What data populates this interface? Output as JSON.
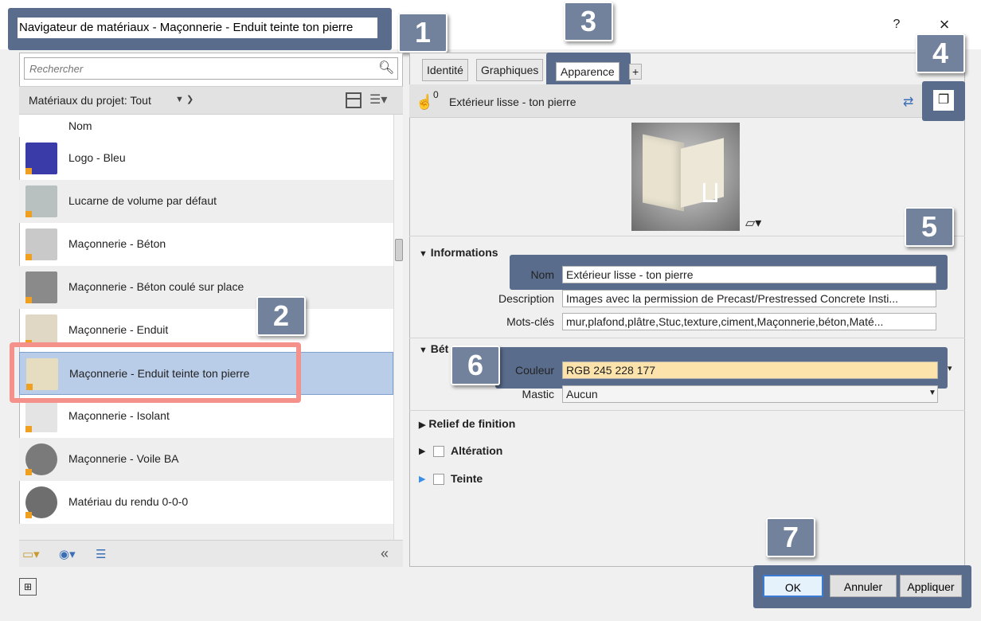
{
  "window": {
    "title": "Navigateur de matériaux - Maçonnerie - Enduit teinte ton pierre",
    "help": "?",
    "close": "×"
  },
  "badges": [
    "1",
    "2",
    "3",
    "4",
    "5",
    "6",
    "7"
  ],
  "browser": {
    "search_placeholder": "Rechercher",
    "filter_label": "Matériaux du projet: Tout",
    "column_header": "Nom",
    "materials": [
      {
        "name": "Logo - Bleu",
        "swatch": "#3a3aa8"
      },
      {
        "name": "Lucarne de volume par défaut",
        "swatch": "#b8c0c0"
      },
      {
        "name": "Maçonnerie - Béton",
        "swatch": "#c9c9c9"
      },
      {
        "name": "Maçonnerie - Béton coulé sur place",
        "swatch": "#8a8a8a"
      },
      {
        "name": "Maçonnerie - Enduit",
        "swatch": "#e0d8c4"
      },
      {
        "name": "Maçonnerie - Enduit teinte ton pierre",
        "swatch": "#e6dcc0",
        "selected": true
      },
      {
        "name": "Maçonnerie - Isolant",
        "swatch": "#e4e4e4"
      },
      {
        "name": "Maçonnerie - Voile BA",
        "swatch": "#7a7a7a"
      },
      {
        "name": "Matériau du rendu 0-0-0",
        "swatch": "#6e6e6e"
      }
    ],
    "collapse": "«"
  },
  "editor": {
    "tabs": [
      "Identité",
      "Graphiques",
      "Apparence",
      "+"
    ],
    "asset_count": "0",
    "asset_name": "Extérieur lisse - ton pierre",
    "sections": {
      "informations": "Informations",
      "beton": "Bét",
      "relief": "Relief de finition",
      "alteration": "Altération",
      "teinte": "Teinte"
    },
    "info": {
      "nom_label": "Nom",
      "nom_value": "Extérieur lisse - ton pierre",
      "description_label": "Description",
      "description_value": "Images avec la permission de Precast/Prestressed Concrete Insti...",
      "motscles_label": "Mots-clés",
      "motscles_value": "mur,plafond,plâtre,Stuc,texture,ciment,Maçonnerie,béton,Maté..."
    },
    "beton": {
      "couleur_label": "Couleur",
      "couleur_value": "RGB 245 228 177",
      "couleur_hex": "#f5e4b1",
      "mastic_label": "Mastic",
      "mastic_value": "Aucun"
    }
  },
  "buttons": {
    "ok": "OK",
    "cancel": "Annuler",
    "apply": "Appliquer"
  }
}
